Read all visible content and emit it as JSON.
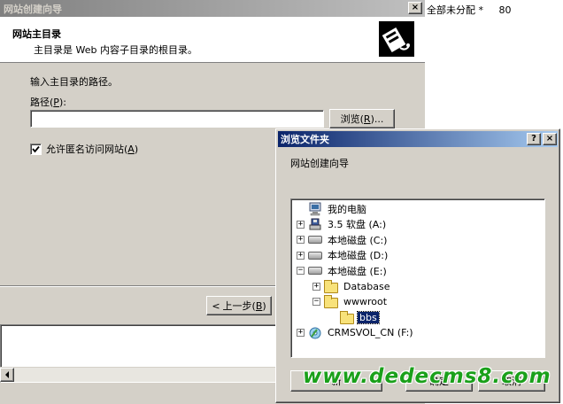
{
  "wizard": {
    "title": "网站创建向导",
    "close_glyph": "×",
    "header_title": "网站主目录",
    "header_desc": "主目录是 Web 内容子目录的根目录。",
    "prompt": "输入主目录的路径。",
    "path_label": "路径",
    "path_mnemonic": "P",
    "path_suffix": "):",
    "path_value": "",
    "browse_label": "浏览",
    "browse_mnemonic": "R",
    "browse_suffix": ")...",
    "anon_label": "允许匿名访问网站",
    "anon_mnemonic": "A",
    "anon_checked": true,
    "back_label": "上一步",
    "back_mnemonic": "B"
  },
  "background_list": {
    "text": "全部未分配 *",
    "port": "80"
  },
  "browse_dialog": {
    "title": "浏览文件夹",
    "help_glyph": "?",
    "close_glyph": "×",
    "description": "网站创建向导",
    "tree": [
      {
        "label": "我的电脑",
        "icon": "computer-icon",
        "expander": ""
      },
      {
        "label": "3.5 软盘 (A:)",
        "icon": "floppy-icon",
        "expander": "+"
      },
      {
        "label": "本地磁盘 (C:)",
        "icon": "drive-icon",
        "expander": "+"
      },
      {
        "label": "本地磁盘 (D:)",
        "icon": "drive-icon",
        "expander": "+"
      },
      {
        "label": "本地磁盘 (E:)",
        "icon": "drive-icon",
        "expander": "−"
      },
      {
        "label": "Database",
        "icon": "folder-icon",
        "expander": "+"
      },
      {
        "label": "wwwroot",
        "icon": "folder-open-icon",
        "expander": "−"
      },
      {
        "label": "bbs",
        "icon": "folder-icon",
        "expander": ""
      },
      {
        "label": "CRMSVOL_CN (F:)",
        "icon": "cdrom-icon",
        "expander": "+"
      }
    ],
    "selected_index": 7,
    "new_folder_label": "新",
    "ok_label": "确定",
    "cancel_label": "取消"
  },
  "watermark": "www.dedecms8.com",
  "colors": {
    "title_active_start": "#0a246a",
    "title_active_end": "#a6caf0",
    "title_inactive_start": "#808080",
    "title_inactive_end": "#c0c0c0",
    "selection": "#0a246a",
    "watermark": "#1aa01a"
  }
}
